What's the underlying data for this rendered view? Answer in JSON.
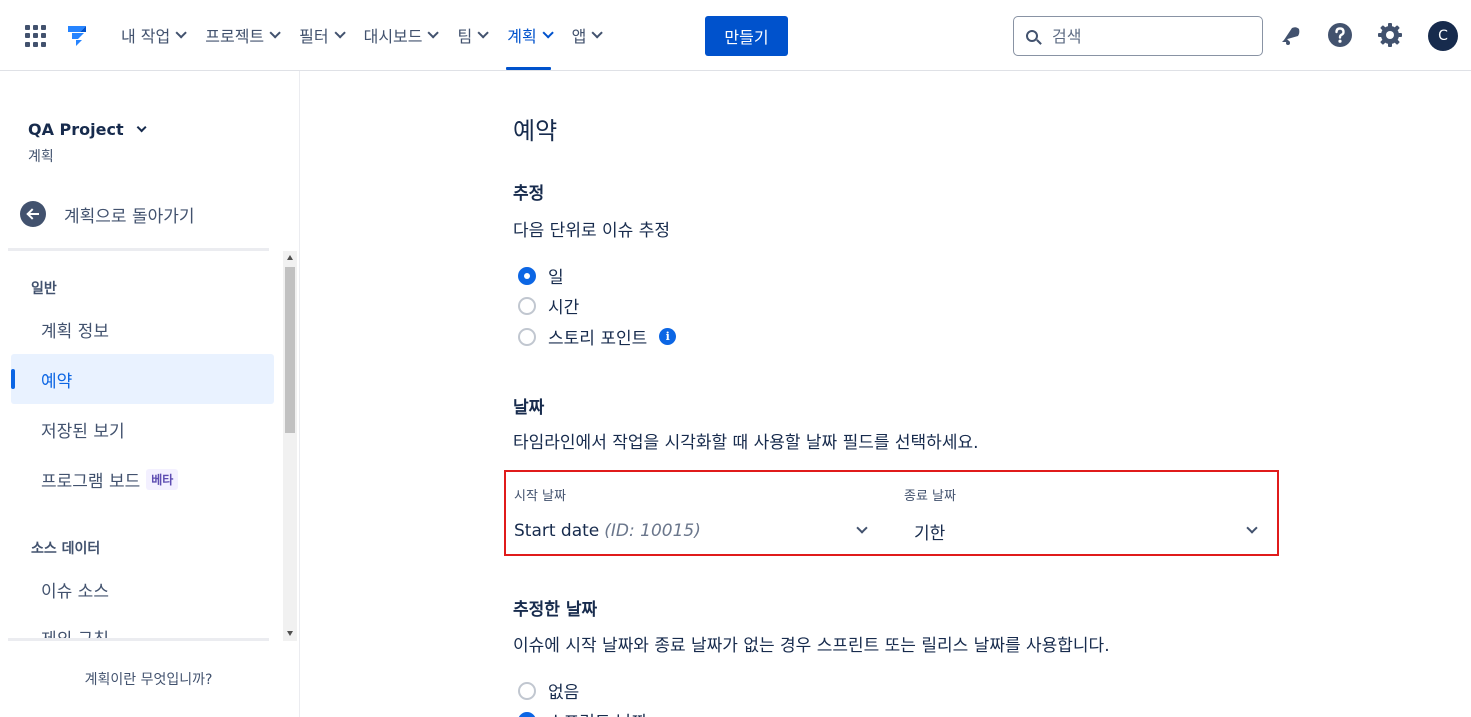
{
  "topnav": {
    "items": [
      {
        "label": "내 작업"
      },
      {
        "label": "프로젝트"
      },
      {
        "label": "필터"
      },
      {
        "label": "대시보드"
      },
      {
        "label": "팀"
      },
      {
        "label": "계획",
        "active": true
      },
      {
        "label": "앱"
      }
    ],
    "create_label": "만들기",
    "search_placeholder": "검색",
    "avatar_initial": "C"
  },
  "sidebar": {
    "project_name": "QA Project",
    "project_sub": "계획",
    "back_label": "계획으로 돌아가기",
    "section_general": "일반",
    "items_general": [
      {
        "label": "계획 정보"
      },
      {
        "label": "예약",
        "active": true
      },
      {
        "label": "저장된 보기"
      },
      {
        "label": "프로그램 보드",
        "badge": "베타"
      }
    ],
    "section_source": "소스 데이터",
    "items_source": [
      {
        "label": "이슈 소스"
      },
      {
        "label": "제외 규칙"
      }
    ],
    "help_link": "계획이란 무엇입니까?"
  },
  "main": {
    "title": "예약",
    "estimation": {
      "heading": "추정",
      "description": "다음 단위로 이슈 추정",
      "options": [
        {
          "label": "일",
          "checked": true
        },
        {
          "label": "시간",
          "checked": false
        },
        {
          "label": "스토리 포인트",
          "checked": false
        }
      ],
      "info_glyph": "i"
    },
    "dates": {
      "heading": "날짜",
      "description": "타임라인에서 작업을 시각화할 때 사용할 날짜 필드를 선택하세요.",
      "start_label": "시작 날짜",
      "start_value": "Start date",
      "start_value_id": "(ID: 10015)",
      "end_label": "종료 날짜",
      "end_value": "기한"
    },
    "inferred": {
      "heading": "추정한 날짜",
      "description": "이슈에 시작 날짜와 종료 날짜가 없는 경우 스프린트 또는 릴리스 날짜를 사용합니다.",
      "options": [
        {
          "label": "없음",
          "checked": false
        },
        {
          "label": "스프린트 날짜",
          "checked": true
        }
      ]
    }
  },
  "colors": {
    "accent": "#0052cc",
    "highlight_border": "#e01b1b",
    "active_bg": "#e9f2ff"
  }
}
